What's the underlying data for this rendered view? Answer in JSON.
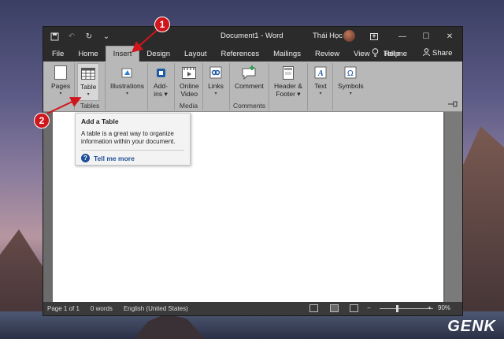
{
  "titlebar": {
    "doc_title": "Document1 - Word",
    "user_name": "Thái Học",
    "quick_access": [
      "save-icon",
      "undo-icon",
      "redo-icon",
      "customize-icon"
    ],
    "window_controls": [
      "ribbon-display-options-icon",
      "minimize-icon",
      "maximize-icon",
      "close-icon"
    ]
  },
  "tabs": {
    "items": [
      "File",
      "Home",
      "Insert",
      "Design",
      "Layout",
      "References",
      "Mailings",
      "Review",
      "View",
      "Help"
    ],
    "active": "Insert",
    "tell_me": "Tell me",
    "share": "Share"
  },
  "ribbon": {
    "pages": {
      "label": "Pages",
      "caret": "▾"
    },
    "table": {
      "label": "Table",
      "caret": "▾",
      "group": "Tables"
    },
    "illustrations": {
      "label": "Illustrations",
      "caret": "▾"
    },
    "addins": {
      "label1": "Add-",
      "label2": "ins ▾"
    },
    "online_video": {
      "label1": "Online",
      "label2": "Video",
      "group": "Media"
    },
    "links": {
      "label": "Links",
      "caret": "▾"
    },
    "comment": {
      "label": "Comment",
      "group": "Comments"
    },
    "header_footer": {
      "label1": "Header &",
      "label2": "Footer ▾"
    },
    "text": {
      "label": "Text",
      "caret": "▾"
    },
    "symbols": {
      "label": "Symbols",
      "caret": "▾"
    }
  },
  "tooltip": {
    "title": "Add a Table",
    "description": "A table is a great way to organize information within your document.",
    "link": "Tell me more"
  },
  "status": {
    "page": "Page 1 of 1",
    "words": "0 words",
    "language": "English (United States)",
    "zoom": "90%",
    "zoom_minus": "−",
    "zoom_plus": "+"
  },
  "callouts": [
    "1",
    "2"
  ],
  "watermark": "GENK",
  "colors": {
    "callout": "#d0161d",
    "ribbon": "#b8b8b8",
    "titlebar": "#2b2b2b",
    "link": "#1f4e9a"
  }
}
